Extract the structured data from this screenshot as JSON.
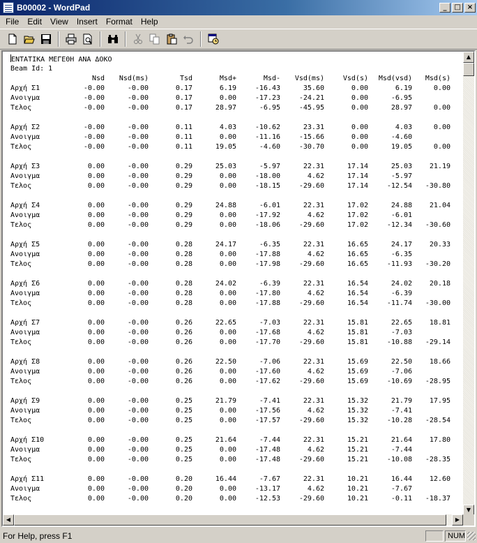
{
  "window": {
    "title": "B00002 - WordPad",
    "minimize": "_",
    "maximize": "□",
    "close": "×"
  },
  "menu": [
    "File",
    "Edit",
    "View",
    "Insert",
    "Format",
    "Help"
  ],
  "toolbar": {
    "buttons": [
      "new",
      "open",
      "save",
      "print",
      "print-preview",
      "find",
      "cut",
      "copy",
      "paste",
      "undo",
      "date-time"
    ]
  },
  "document": {
    "heading": "ΕΝΤΑΤΙΚΑ ΜΕΓΕΘΗ ΑΝΑ ΔΟΚΟ",
    "beam_id": "Beam Id: 1",
    "columns": [
      "",
      "Nsd",
      "Nsd(ms)",
      "Tsd",
      "Msd+",
      "Msd-",
      "Vsd(ms)",
      "Vsd(s)",
      "Msd(vsd)",
      "Msd(s)"
    ],
    "groups": [
      {
        "rows": [
          [
            "Αρχή Σ1",
            "-0.00",
            "-0.00",
            "0.17",
            "6.19",
            "-16.43",
            "35.60",
            "0.00",
            "6.19",
            "0.00"
          ],
          [
            "Ανοιγμα",
            "-0.00",
            "-0.00",
            "0.17",
            "0.00",
            "-17.23",
            "-24.21",
            "0.00",
            "-6.95",
            ""
          ],
          [
            "Τελος",
            "-0.00",
            "-0.00",
            "0.17",
            "28.97",
            "-6.95",
            "-45.95",
            "0.00",
            "28.97",
            "0.00"
          ]
        ]
      },
      {
        "rows": [
          [
            "Αρχή Σ2",
            "-0.00",
            "-0.00",
            "0.11",
            "4.03",
            "-10.62",
            "23.31",
            "0.00",
            "4.03",
            "0.00"
          ],
          [
            "Ανοιγμα",
            "-0.00",
            "-0.00",
            "0.11",
            "0.00",
            "-11.16",
            "-15.66",
            "0.00",
            "-4.60",
            ""
          ],
          [
            "Τελος",
            "-0.00",
            "-0.00",
            "0.11",
            "19.05",
            "-4.60",
            "-30.70",
            "0.00",
            "19.05",
            "0.00"
          ]
        ]
      },
      {
        "rows": [
          [
            "Αρχή Σ3",
            "0.00",
            "-0.00",
            "0.29",
            "25.03",
            "-5.97",
            "22.31",
            "17.14",
            "25.03",
            "21.19"
          ],
          [
            "Ανοιγμα",
            "0.00",
            "-0.00",
            "0.29",
            "0.00",
            "-18.00",
            "4.62",
            "17.14",
            "-5.97",
            ""
          ],
          [
            "Τελος",
            "0.00",
            "-0.00",
            "0.29",
            "0.00",
            "-18.15",
            "-29.60",
            "17.14",
            "-12.54",
            "-30.80"
          ]
        ]
      },
      {
        "rows": [
          [
            "Αρχή Σ4",
            "0.00",
            "-0.00",
            "0.29",
            "24.88",
            "-6.01",
            "22.31",
            "17.02",
            "24.88",
            "21.04"
          ],
          [
            "Ανοιγμα",
            "0.00",
            "-0.00",
            "0.29",
            "0.00",
            "-17.92",
            "4.62",
            "17.02",
            "-6.01",
            ""
          ],
          [
            "Τελος",
            "0.00",
            "-0.00",
            "0.29",
            "0.00",
            "-18.06",
            "-29.60",
            "17.02",
            "-12.34",
            "-30.60"
          ]
        ]
      },
      {
        "rows": [
          [
            "Αρχή Σ5",
            "0.00",
            "-0.00",
            "0.28",
            "24.17",
            "-6.35",
            "22.31",
            "16.65",
            "24.17",
            "20.33"
          ],
          [
            "Ανοιγμα",
            "0.00",
            "-0.00",
            "0.28",
            "0.00",
            "-17.88",
            "4.62",
            "16.65",
            "-6.35",
            ""
          ],
          [
            "Τελος",
            "0.00",
            "-0.00",
            "0.28",
            "0.00",
            "-17.98",
            "-29.60",
            "16.65",
            "-11.93",
            "-30.20"
          ]
        ]
      },
      {
        "rows": [
          [
            "Αρχή Σ6",
            "0.00",
            "-0.00",
            "0.28",
            "24.02",
            "-6.39",
            "22.31",
            "16.54",
            "24.02",
            "20.18"
          ],
          [
            "Ανοιγμα",
            "0.00",
            "-0.00",
            "0.28",
            "0.00",
            "-17.80",
            "4.62",
            "16.54",
            "-6.39",
            ""
          ],
          [
            "Τελος",
            "0.00",
            "-0.00",
            "0.28",
            "0.00",
            "-17.88",
            "-29.60",
            "16.54",
            "-11.74",
            "-30.00"
          ]
        ]
      },
      {
        "rows": [
          [
            "Αρχή Σ7",
            "0.00",
            "-0.00",
            "0.26",
            "22.65",
            "-7.03",
            "22.31",
            "15.81",
            "22.65",
            "18.81"
          ],
          [
            "Ανοιγμα",
            "0.00",
            "-0.00",
            "0.26",
            "0.00",
            "-17.68",
            "4.62",
            "15.81",
            "-7.03",
            ""
          ],
          [
            "Τελος",
            "0.00",
            "-0.00",
            "0.26",
            "0.00",
            "-17.70",
            "-29.60",
            "15.81",
            "-10.88",
            "-29.14"
          ]
        ]
      },
      {
        "rows": [
          [
            "Αρχή Σ8",
            "0.00",
            "-0.00",
            "0.26",
            "22.50",
            "-7.06",
            "22.31",
            "15.69",
            "22.50",
            "18.66"
          ],
          [
            "Ανοιγμα",
            "0.00",
            "-0.00",
            "0.26",
            "0.00",
            "-17.60",
            "4.62",
            "15.69",
            "-7.06",
            ""
          ],
          [
            "Τελος",
            "0.00",
            "-0.00",
            "0.26",
            "0.00",
            "-17.62",
            "-29.60",
            "15.69",
            "-10.69",
            "-28.95"
          ]
        ]
      },
      {
        "rows": [
          [
            "Αρχή Σ9",
            "0.00",
            "-0.00",
            "0.25",
            "21.79",
            "-7.41",
            "22.31",
            "15.32",
            "21.79",
            "17.95"
          ],
          [
            "Ανοιγμα",
            "0.00",
            "-0.00",
            "0.25",
            "0.00",
            "-17.56",
            "4.62",
            "15.32",
            "-7.41",
            ""
          ],
          [
            "Τελος",
            "0.00",
            "-0.00",
            "0.25",
            "0.00",
            "-17.57",
            "-29.60",
            "15.32",
            "-10.28",
            "-28.54"
          ]
        ]
      },
      {
        "rows": [
          [
            "Αρχή Σ10",
            "0.00",
            "-0.00",
            "0.25",
            "21.64",
            "-7.44",
            "22.31",
            "15.21",
            "21.64",
            "17.80"
          ],
          [
            "Ανοιγμα",
            "0.00",
            "-0.00",
            "0.25",
            "0.00",
            "-17.48",
            "4.62",
            "15.21",
            "-7.44",
            ""
          ],
          [
            "Τελος",
            "0.00",
            "-0.00",
            "0.25",
            "0.00",
            "-17.48",
            "-29.60",
            "15.21",
            "-10.08",
            "-28.35"
          ]
        ]
      },
      {
        "rows": [
          [
            "Αρχή Σ11",
            "0.00",
            "-0.00",
            "0.20",
            "16.44",
            "-7.67",
            "22.31",
            "10.21",
            "16.44",
            "12.60"
          ],
          [
            "Ανοιγμα",
            "0.00",
            "-0.00",
            "0.20",
            "0.00",
            "-13.17",
            "4.62",
            "10.21",
            "-7.67",
            ""
          ],
          [
            "Τελος",
            "0.00",
            "-0.00",
            "0.20",
            "0.00",
            "-12.53",
            "-29.60",
            "10.21",
            "-0.11",
            "-18.37"
          ]
        ]
      }
    ]
  },
  "status": {
    "help_text": "For Help, press F1",
    "num": "NUM"
  }
}
